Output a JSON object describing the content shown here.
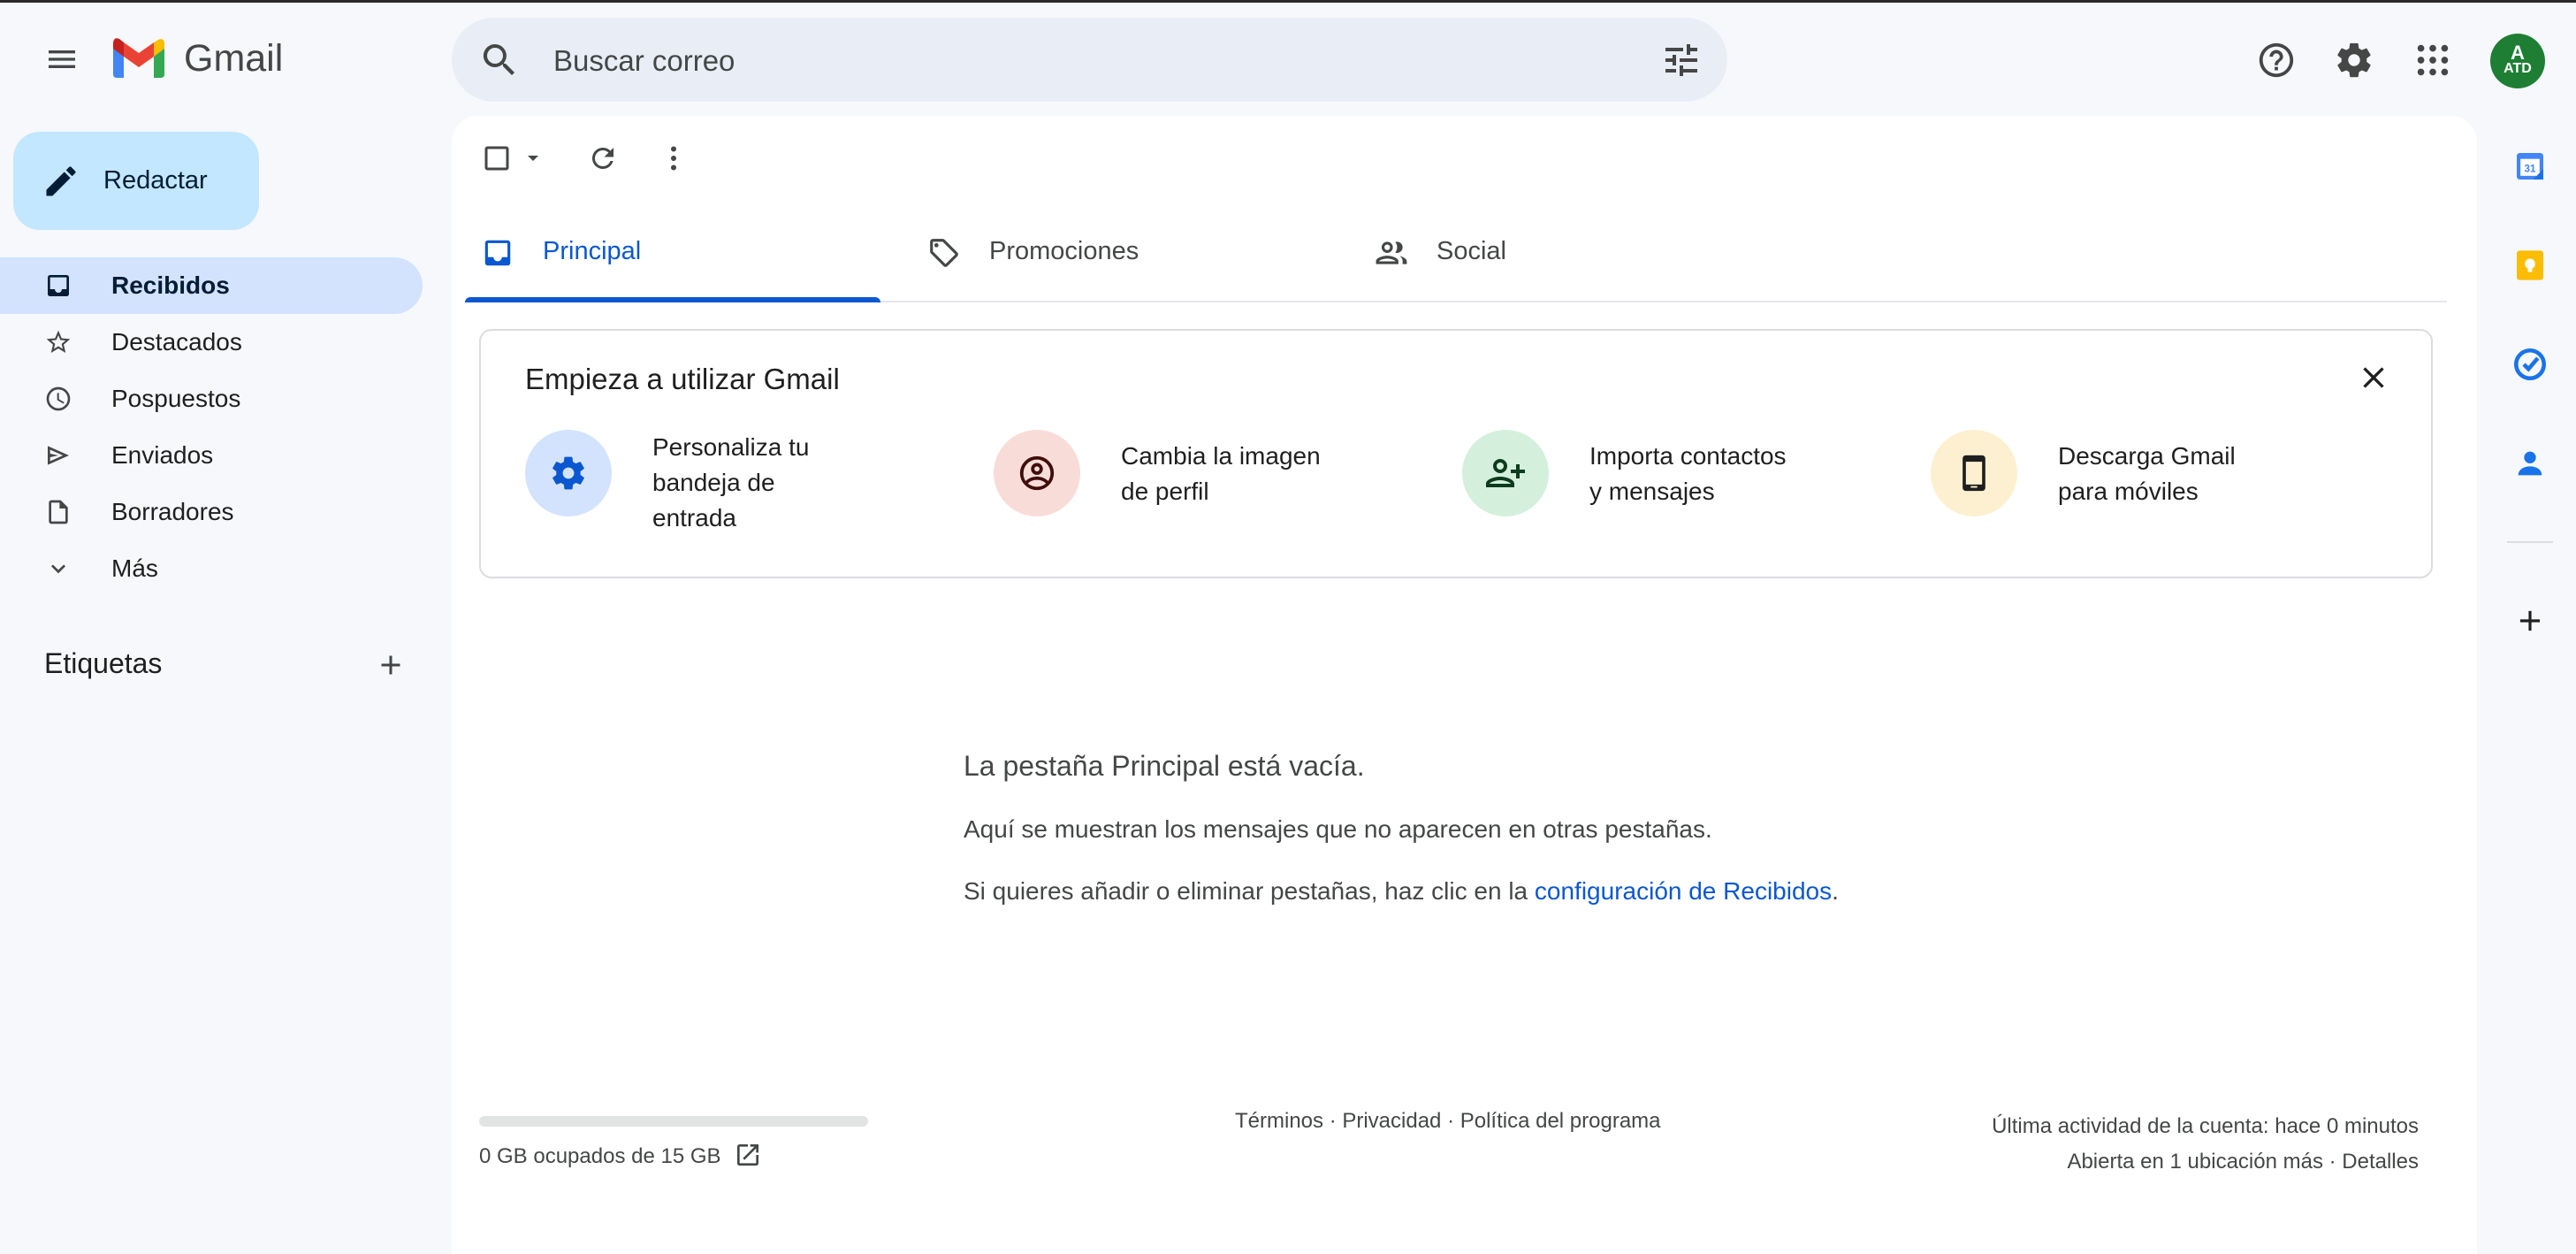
{
  "app": {
    "name": "Gmail"
  },
  "header": {
    "search_placeholder": "Buscar correo",
    "avatar_initial": "A",
    "avatar_sub": "ATD"
  },
  "compose": {
    "label": "Redactar"
  },
  "nav": {
    "items": [
      {
        "label": "Recibidos",
        "icon": "inbox-icon",
        "active": true
      },
      {
        "label": "Destacados",
        "icon": "star-icon"
      },
      {
        "label": "Pospuestos",
        "icon": "clock-icon"
      },
      {
        "label": "Enviados",
        "icon": "send-icon"
      },
      {
        "label": "Borradores",
        "icon": "draft-icon"
      },
      {
        "label": "Más",
        "icon": "chevron-down-icon"
      }
    ]
  },
  "labels": {
    "title": "Etiquetas"
  },
  "tabs": [
    {
      "label": "Principal",
      "icon": "inbox-icon",
      "active": true
    },
    {
      "label": "Promociones",
      "icon": "tag-icon"
    },
    {
      "label": "Social",
      "icon": "people-icon"
    }
  ],
  "onboarding": {
    "title": "Empieza a utilizar Gmail",
    "items": [
      {
        "lines": [
          "Personaliza tu",
          "bandeja de",
          "entrada"
        ],
        "icon": "gear-icon",
        "color": "#d3e3fd"
      },
      {
        "lines": [
          "Cambia la imagen",
          "de perfil"
        ],
        "icon": "account-circle-icon",
        "color": "#f8dcd8"
      },
      {
        "lines": [
          "Importa contactos",
          "y mensajes"
        ],
        "icon": "person-add-icon",
        "color": "#d4f0dc"
      },
      {
        "lines": [
          "Descarga Gmail",
          "para móviles"
        ],
        "icon": "phone-icon",
        "color": "#fdf0d0"
      }
    ]
  },
  "empty": {
    "title": "La pestaña Principal está vacía.",
    "line1": "Aquí se muestran los mensajes que no aparecen en otras pestañas.",
    "line2_prefix": "Si quieres añadir o eliminar pestañas, haz clic en la ",
    "line2_link": "configuración de Recibidos",
    "line2_suffix": "."
  },
  "footer": {
    "storage_text": "0 GB ocupados de 15 GB",
    "storage_used_fraction": 0,
    "links": "Términos · Privacidad · Política del programa",
    "activity": "Última actividad de la cuenta: hace 0 minutos",
    "details": "Abierta en 1 ubicación más · Detalles"
  },
  "colors": {
    "accent": "#0b57d0",
    "compose_bg": "#c2e7ff",
    "active_nav_bg": "#d3e3fd",
    "avatar_bg": "#1e7e34"
  }
}
